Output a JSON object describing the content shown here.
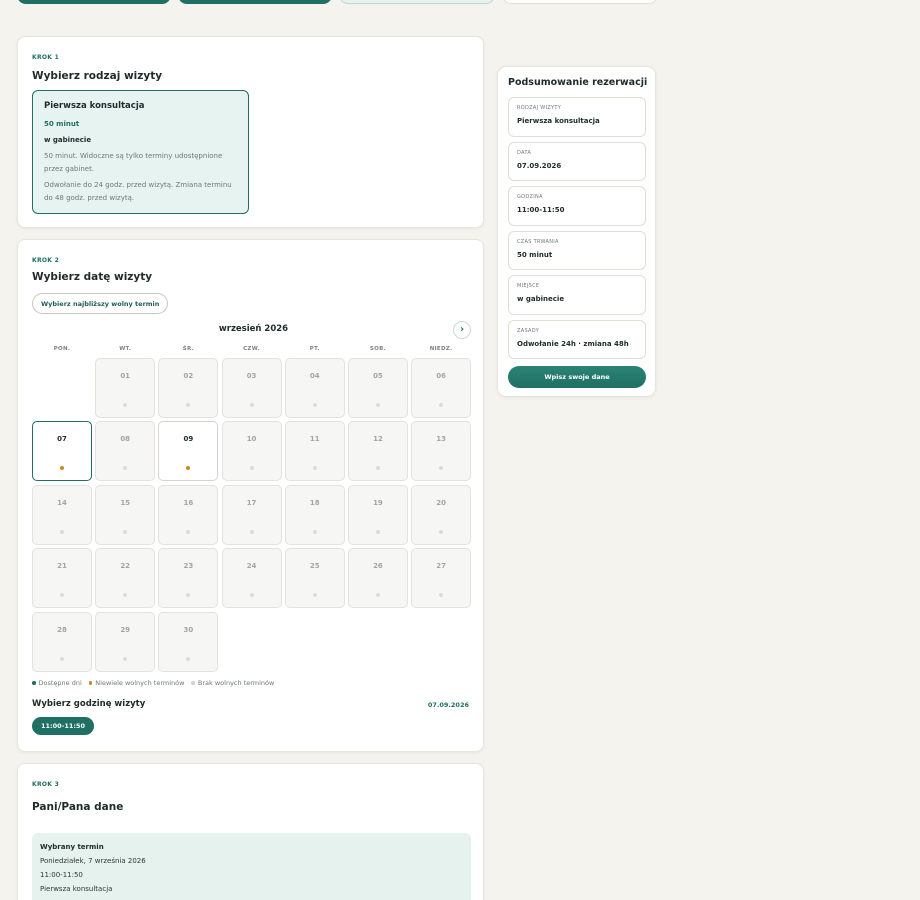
{
  "colors": {
    "accent": "#1f6f64",
    "available_dot": "#c8892f",
    "light_accent": "#e7f3f0",
    "background": "#f4f3ee"
  },
  "step1": {
    "label": "KROK 1",
    "title": "Wybierz rodzaj wizyty",
    "option": {
      "title": "Pierwsza konsultacja",
      "duration": "50 minut",
      "place": "w gabinecie",
      "description": "50 minut. Widoczne są tylko terminy udostępnione przez gabinet.",
      "policy": "Odwołanie do 24 godz. przed wizytą. Zmiana terminu do 48 godz. przed wizytą."
    }
  },
  "step2": {
    "label": "KROK 2",
    "title": "Wybierz datę wizyty",
    "nearest_button": "Wybierz najbliższy wolny termin",
    "month": "wrzesień 2026",
    "next_icon": "›",
    "weekdays": [
      "PON.",
      "WT.",
      "ŚR.",
      "CZW.",
      "PT.",
      "SOB.",
      "NIEDZ."
    ],
    "days": [
      {
        "n": "",
        "state": "blank"
      },
      {
        "n": "01",
        "state": "none"
      },
      {
        "n": "02",
        "state": "none"
      },
      {
        "n": "03",
        "state": "none"
      },
      {
        "n": "04",
        "state": "none"
      },
      {
        "n": "05",
        "state": "none"
      },
      {
        "n": "06",
        "state": "none"
      },
      {
        "n": "07",
        "state": "selected"
      },
      {
        "n": "08",
        "state": "none"
      },
      {
        "n": "09",
        "state": "avail"
      },
      {
        "n": "10",
        "state": "none"
      },
      {
        "n": "11",
        "state": "none"
      },
      {
        "n": "12",
        "state": "none"
      },
      {
        "n": "13",
        "state": "none"
      },
      {
        "n": "14",
        "state": "none"
      },
      {
        "n": "15",
        "state": "none"
      },
      {
        "n": "16",
        "state": "none"
      },
      {
        "n": "17",
        "state": "none"
      },
      {
        "n": "18",
        "state": "none"
      },
      {
        "n": "19",
        "state": "none"
      },
      {
        "n": "20",
        "state": "none"
      },
      {
        "n": "21",
        "state": "none"
      },
      {
        "n": "22",
        "state": "none"
      },
      {
        "n": "23",
        "state": "none"
      },
      {
        "n": "24",
        "state": "none"
      },
      {
        "n": "25",
        "state": "none"
      },
      {
        "n": "26",
        "state": "none"
      },
      {
        "n": "27",
        "state": "none"
      },
      {
        "n": "28",
        "state": "none"
      },
      {
        "n": "29",
        "state": "none"
      },
      {
        "n": "30",
        "state": "none"
      }
    ],
    "legend": [
      {
        "label": "Dostępne dni",
        "color": "#1f6f64"
      },
      {
        "label": "Niewiele wolnych terminów",
        "color": "#c8892f"
      },
      {
        "label": "Brak wolnych terminów",
        "color": "#d4d3ce"
      }
    ],
    "time_title": "Wybierz godzinę wizyty",
    "time_date": "07.09.2026",
    "slot": "11:00-11:50"
  },
  "step3": {
    "label": "KROK 3",
    "title": "Pani/Pana dane",
    "chosen_title": "Wybrany termin",
    "chosen_date": "Poniedziałek, 7 września 2026",
    "chosen_time": "11:00-11:50",
    "chosen_type": "Pierwsza konsultacja"
  },
  "summary": {
    "title": "Podsumowanie rezerwacji",
    "items": [
      {
        "label": "RODZAJ WIZYTY",
        "value": "Pierwsza konsultacja"
      },
      {
        "label": "DATA",
        "value": "07.09.2026"
      },
      {
        "label": "GODZINA",
        "value": "11:00-11:50"
      },
      {
        "label": "CZAS TRWANIA",
        "value": "50 minut"
      },
      {
        "label": "MIEJSCE",
        "value": "w gabinecie"
      },
      {
        "label": "ZASADY",
        "value": "Odwołanie 24h · zmiana 48h"
      }
    ],
    "button": "Wpisz swoje dane"
  }
}
